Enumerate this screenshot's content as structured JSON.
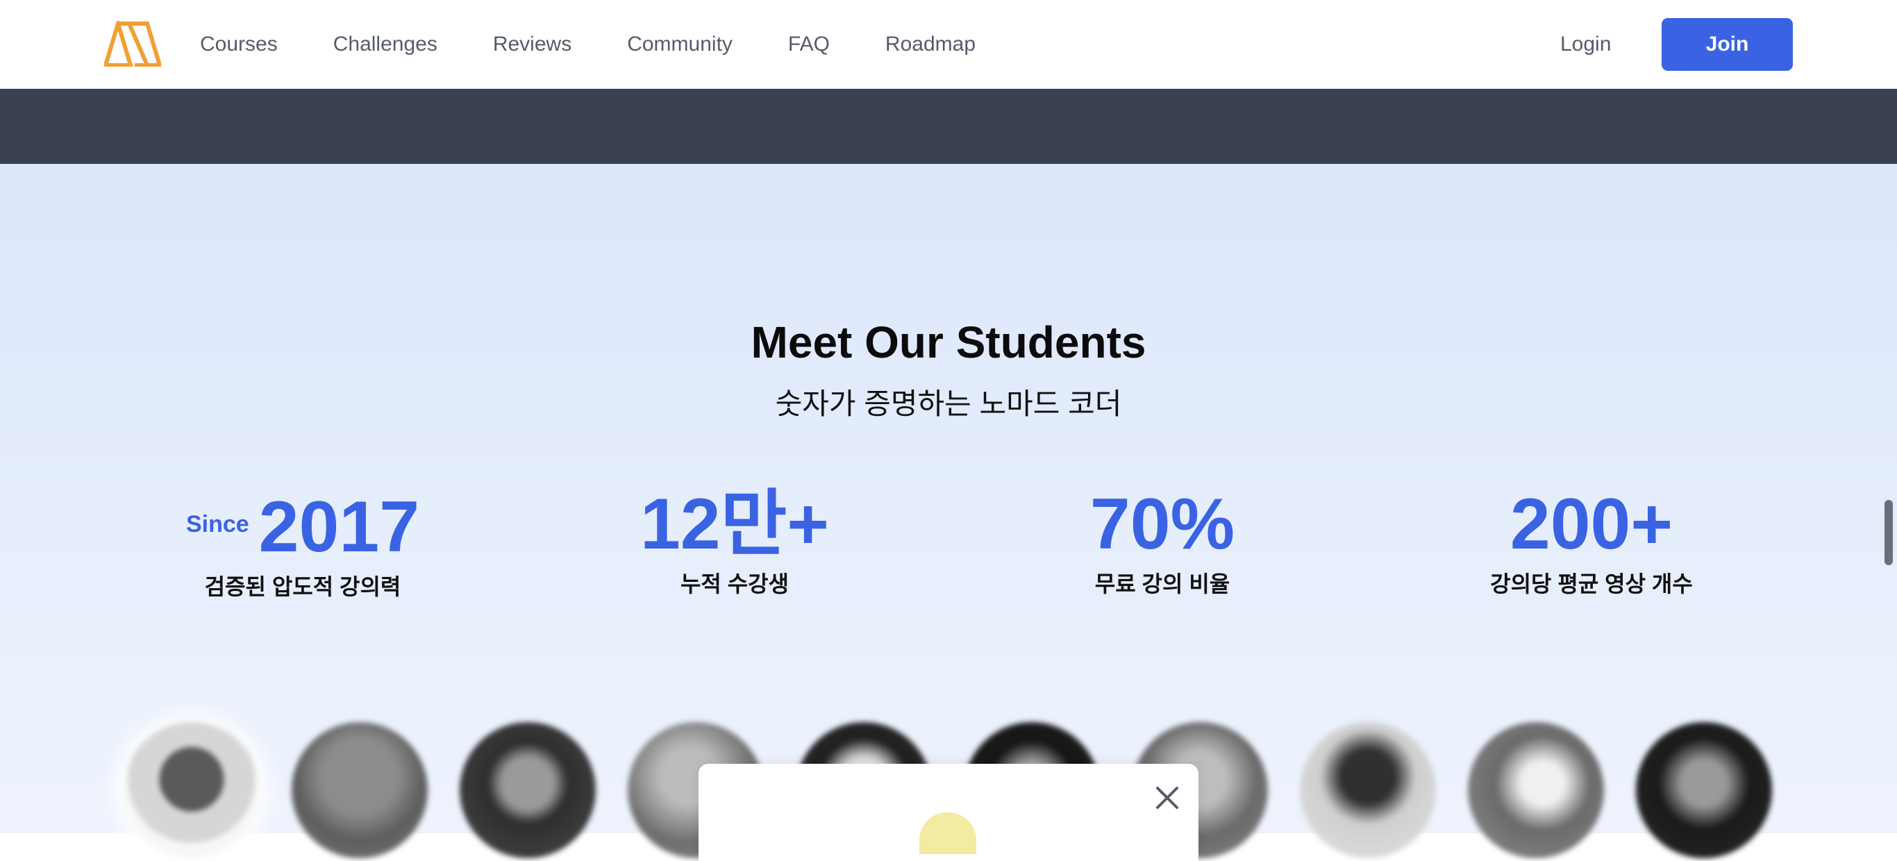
{
  "nav": {
    "links": [
      "Courses",
      "Challenges",
      "Reviews",
      "Community",
      "FAQ",
      "Roadmap"
    ],
    "login": "Login",
    "join": "Join"
  },
  "hero": {
    "title": "Meet Our Students",
    "subtitle": "숫자가 증명하는 노마드 코더"
  },
  "stats": [
    {
      "prefix": "Since",
      "value": "2017",
      "label": "검증된 압도적 강의력"
    },
    {
      "value": "12만+",
      "label": "누적 수강생"
    },
    {
      "value": "70%",
      "label": "무료 강의 비율"
    },
    {
      "value": "200+",
      "label": "강의당 평균 영상 개수"
    }
  ],
  "colors": {
    "accent": "#3a63e3",
    "logo": "#f0a032",
    "dark_band": "#3a4150"
  },
  "icons": {
    "logo": "nomad-logo-icon",
    "close": "close-icon"
  }
}
